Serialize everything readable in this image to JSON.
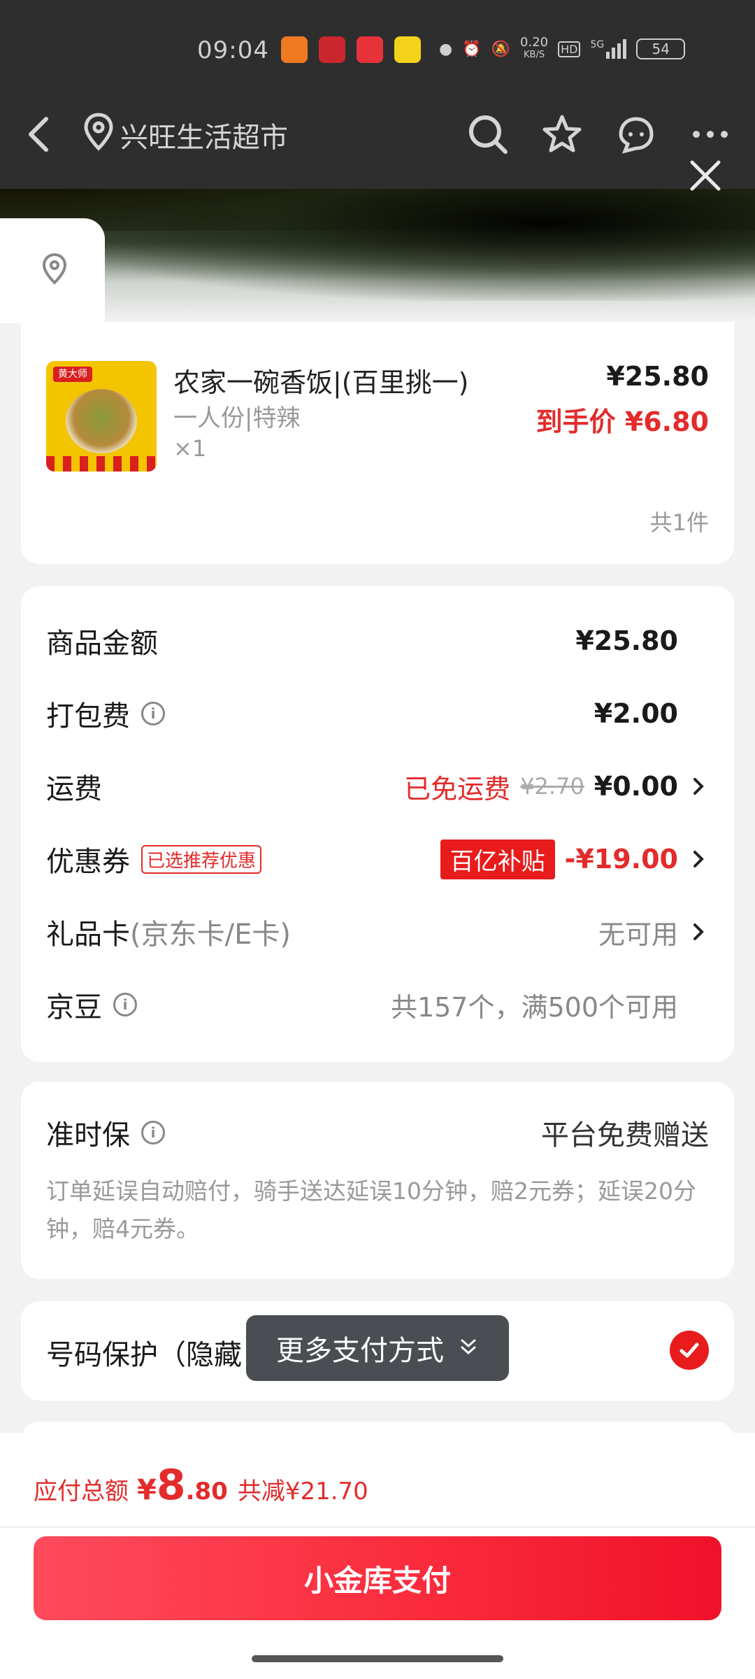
{
  "status_bar": {
    "time": "09:04",
    "net_speed_top": "0.20",
    "net_speed_bottom": "KB/S",
    "hd": "HD",
    "signal": "5G",
    "battery": "54"
  },
  "nav": {
    "store_name": "兴旺生活超市"
  },
  "product": {
    "title": "农家一碗香饭|(百里挑一)",
    "spec": "一人份|特辣",
    "qty": "×1",
    "price": "¥25.80",
    "final_price": "到手价 ¥6.80",
    "count": "共1件",
    "thumb_tag": "黄大师"
  },
  "summary": {
    "goods_label": "商品金额",
    "goods_value": "¥25.80",
    "pack_label": "打包费",
    "pack_value": "¥2.00",
    "ship_label": "运费",
    "ship_free": "已免运费",
    "ship_original": "¥2.70",
    "ship_value": "¥0.00",
    "coupon_label": "优惠券",
    "coupon_tag": "已选推荐优惠",
    "coupon_subsidy": "百亿补贴",
    "coupon_value": "-¥19.00",
    "giftcard_label": "礼品卡",
    "giftcard_sub": "(京东卡/E卡)",
    "giftcard_value": "无可用",
    "beans_label": "京豆",
    "beans_value": "共157个，满500个可用"
  },
  "ontime": {
    "title": "准时保",
    "free": "平台免费赠送",
    "desc": "订单延误自动赔付，骑手送达延误10分钟，赔2元券；延误20分钟，赔4元券。"
  },
  "phone": {
    "title": "号码保护（隐藏"
  },
  "more_pay": {
    "label": "更多支付方式"
  },
  "bottom": {
    "total_label": "应付总额",
    "currency": "¥",
    "total_int": "8",
    "total_dec": ".80",
    "reduced": "共减¥21.70",
    "pay_button": "小金库支付"
  },
  "colors": {
    "accent": "#e32b2b",
    "pay_button": "#fa2c3c",
    "dark_header": "#2e2e2e"
  }
}
